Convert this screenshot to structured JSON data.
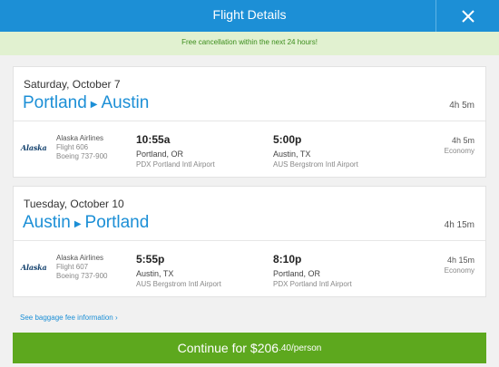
{
  "header": {
    "title": "Flight Details"
  },
  "notice": "Free cancellation within the next 24 hours!",
  "flights": [
    {
      "date": "Saturday, October 7",
      "origin": "Portland",
      "destination": "Austin",
      "duration": "4h 5m",
      "airline_logo": "Alaska",
      "airline": "Alaska Airlines",
      "flight_number": "Flight 606",
      "aircraft": "Boeing 737-900",
      "depart_time": "10:55a",
      "depart_city": "Portland, OR",
      "depart_airport": "PDX Portland Intl Airport",
      "arrive_time": "5:00p",
      "arrive_city": "Austin, TX",
      "arrive_airport": "AUS Bergstrom Intl Airport",
      "segment_duration": "4h 5m",
      "cabin": "Economy"
    },
    {
      "date": "Tuesday, October 10",
      "origin": "Austin",
      "destination": "Portland",
      "duration": "4h 15m",
      "airline_logo": "Alaska",
      "airline": "Alaska Airlines",
      "flight_number": "Flight 607",
      "aircraft": "Boeing 737-900",
      "depart_time": "5:55p",
      "depart_city": "Austin, TX",
      "depart_airport": "AUS Bergstrom Intl Airport",
      "arrive_time": "8:10p",
      "arrive_city": "Portland, OR",
      "arrive_airport": "PDX Portland Intl Airport",
      "segment_duration": "4h 15m",
      "cabin": "Economy"
    }
  ],
  "baggage_link": "See baggage fee information ›",
  "continue": {
    "label": "Continue for",
    "price": "$206",
    "cents": ".40/person"
  },
  "colors": {
    "header": "#1c8fd6",
    "notice_bg": "#e1f1d0",
    "notice_text": "#3c8d1c",
    "button": "#5da81e"
  },
  "icons": {
    "close": "close-icon",
    "route_arrow": "triangle-right-icon"
  }
}
